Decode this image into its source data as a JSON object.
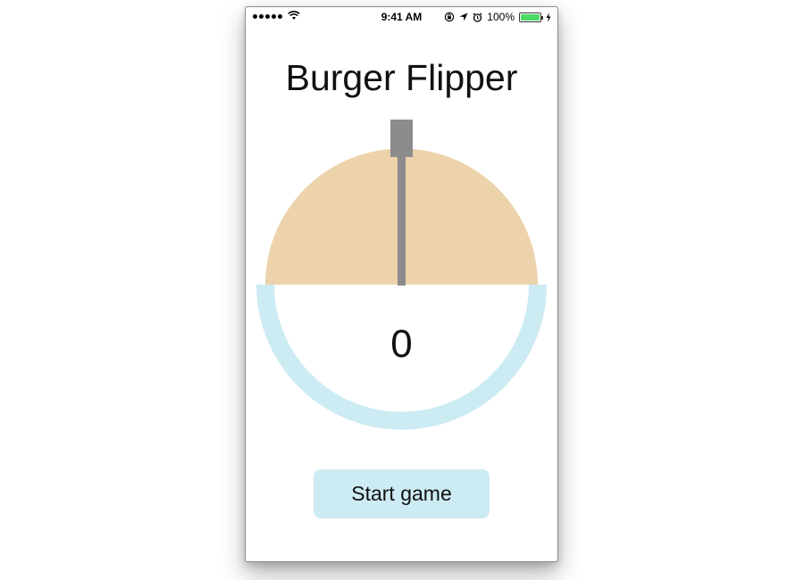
{
  "status_bar": {
    "time": "9:41 AM",
    "battery_percent": "100%",
    "icons": [
      "signal-dots-icon",
      "wifi-icon",
      "rotation-lock-icon",
      "location-arrow-icon",
      "alarm-icon",
      "battery-icon",
      "charging-bolt-icon"
    ]
  },
  "app": {
    "title": "Burger Flipper",
    "score": "0",
    "start_label": "Start game"
  },
  "colors": {
    "bun": "#ecd3ab",
    "ring": "#cdebf3",
    "spatula": "#8c8c8c",
    "button_bg": "#cdebf3"
  }
}
